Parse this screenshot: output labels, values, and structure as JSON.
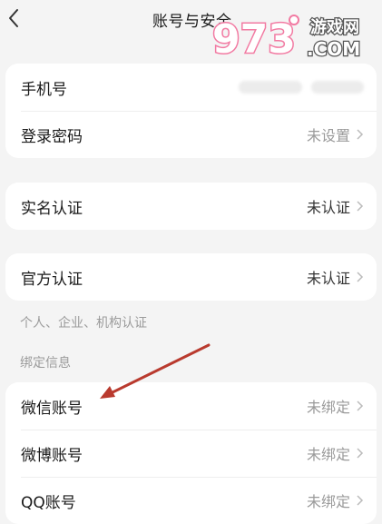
{
  "header": {
    "title": "账号与安全"
  },
  "watermark": {
    "digits": "973",
    "line1": "游戏网",
    "line2": ".COM"
  },
  "phone": {
    "label": "手机号"
  },
  "password": {
    "label": "登录密码",
    "value": "未设置"
  },
  "realname": {
    "label": "实名认证",
    "value": "未认证"
  },
  "official": {
    "label": "官方认证",
    "value": "未认证",
    "note": "个人、企业、机构认证"
  },
  "binding": {
    "section_title": "绑定信息",
    "items": [
      {
        "label": "微信账号",
        "value": "未绑定"
      },
      {
        "label": "微博账号",
        "value": "未绑定"
      },
      {
        "label": "QQ账号",
        "value": "未绑定"
      }
    ]
  },
  "colors": {
    "annotation_arrow": "#b93a2e",
    "watermark_pink": "#f27aa2",
    "watermark_orange": "#f7a24a"
  }
}
